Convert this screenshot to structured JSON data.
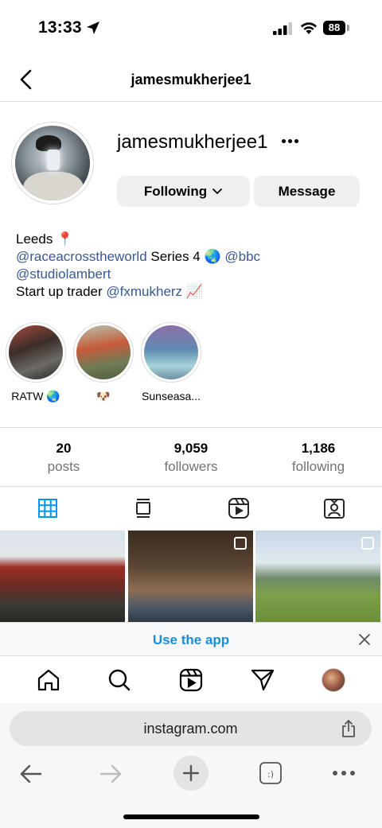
{
  "status_bar": {
    "time": "13:33",
    "battery": "88",
    "icons": [
      "location-arrow-icon",
      "signal-icon",
      "wifi-icon",
      "battery-icon"
    ]
  },
  "header": {
    "title": "jamesmukherjee1",
    "back_icon": "chevron-left-icon"
  },
  "profile": {
    "username": "jamesmukherjee1",
    "following_label": "Following",
    "message_label": "Message",
    "bio": {
      "line1": "Leeds 📍",
      "line2_link1": "@raceacrosstheworld",
      "line2_text": " Series 4 🌏 ",
      "line2_link2": "@bbc",
      "line3_link": "@studiolambert",
      "line4_text": "Start up trader ",
      "line4_link": "@fxmukherz",
      "line4_emoji": " 📈"
    }
  },
  "highlights": [
    {
      "label": "RATW 🌏"
    },
    {
      "label": "🐶"
    },
    {
      "label": "Sunseasa..."
    }
  ],
  "stats": [
    {
      "number": "20",
      "label": "posts"
    },
    {
      "number": "9,059",
      "label": "followers"
    },
    {
      "number": "1,186",
      "label": "following"
    }
  ],
  "tabs": [
    "grid-icon",
    "feed-icon",
    "reels-icon",
    "tagged-icon"
  ],
  "banner": {
    "text": "Use the app"
  },
  "bottom_nav": [
    "home-icon",
    "search-icon",
    "reels-icon",
    "direct-icon",
    "profile-avatar"
  ],
  "safari": {
    "url": "instagram.com"
  },
  "colors": {
    "link": "#385898",
    "accent": "#0095f6",
    "banner_text": "#1a8cd8"
  }
}
